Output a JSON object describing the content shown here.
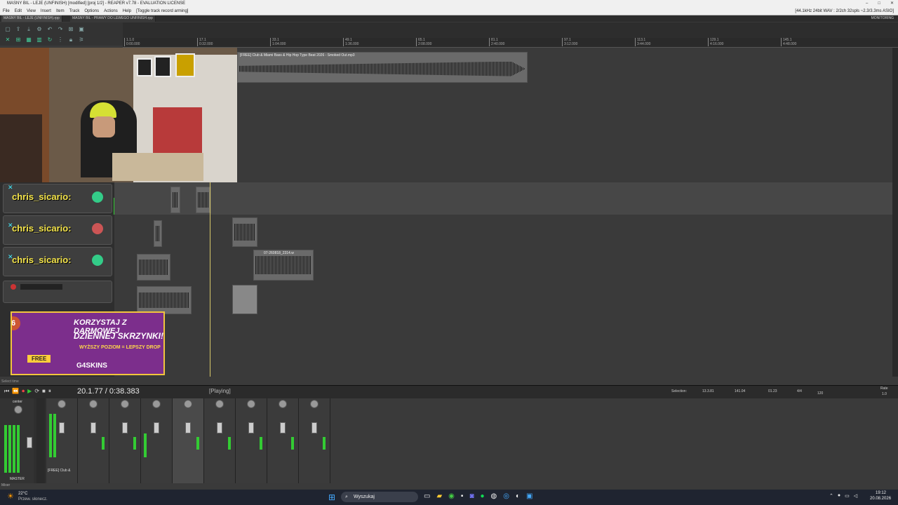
{
  "window": {
    "title": "MASNY BIL - LEJE (UNFINISH) [modified] [proj 1/2] - REAPER v7.78 - EVALUATION LICENSE"
  },
  "menu": {
    "items": [
      "File",
      "Edit",
      "View",
      "Insert",
      "Item",
      "Track",
      "Options",
      "Actions",
      "Help",
      "[Toggle track record arming]"
    ],
    "status": "[44.1kHz 24bit WAV : 2/2ch 32spls ~2.3/3.3ms ASIO]"
  },
  "tabs": {
    "tab1": "MASNY BIL - LEJE (UNFINISH).rpp",
    "tab2": "MASNY BIL - PRAWY DO LEWEGO UNFINISH.rpp",
    "tab_right": "MONITORING"
  },
  "ruler": {
    "marks": [
      "1.1.0",
      "17.1",
      "33.1",
      "49.1",
      "65.1",
      "81.1",
      "97.1",
      "113.1",
      "129.1",
      "145.1"
    ],
    "times": [
      "0:00.000",
      "0:32.000",
      "1:04.000",
      "1:36.000",
      "2:08.000",
      "2:40.000",
      "3:12.000",
      "3:44.000",
      "4:16.000",
      "4:48.000"
    ]
  },
  "items": {
    "beat_item": "[FREE] Club & Miami Bass & Hip Hop Type Beat 2026 - Smoked Out.mp3",
    "vox_item": "07-260818_2314.w"
  },
  "chat": {
    "line1": "chris_sicario:",
    "line2": "chris_sicario:",
    "line3": "chris_sicario:"
  },
  "promo": {
    "badge": "6",
    "headline1": "KORZYSTAJ Z DARMOWEJ",
    "headline2": "DZIENNEJ SKRZYNKI!",
    "sub": "WYŻSZY POZIOM = LEPSZY DROP",
    "free": "FREE",
    "brand": "G4SKINS"
  },
  "transport": {
    "status_left": "Select time",
    "time": "20.1.77 / 0:38.383",
    "state": "[Playing]",
    "selection_label": "Selection:",
    "sel_start": "13.3.81",
    "sel_end": "141.04",
    "sel_len": "01.23",
    "timesig": "4/4",
    "bpm": "120",
    "rate_label": "Rate",
    "rate": "1.0"
  },
  "mixer": {
    "master_label": "MASTER",
    "center_label": "center",
    "first_track_name": "[FREE] Club &",
    "mixer_tab": "Mixer"
  },
  "taskbar": {
    "weather_temp": "22°C",
    "weather_desc": "Przew. słonecz.",
    "search_placeholder": "Wyszukaj",
    "time": "19:12",
    "date": "20.08.2026"
  }
}
